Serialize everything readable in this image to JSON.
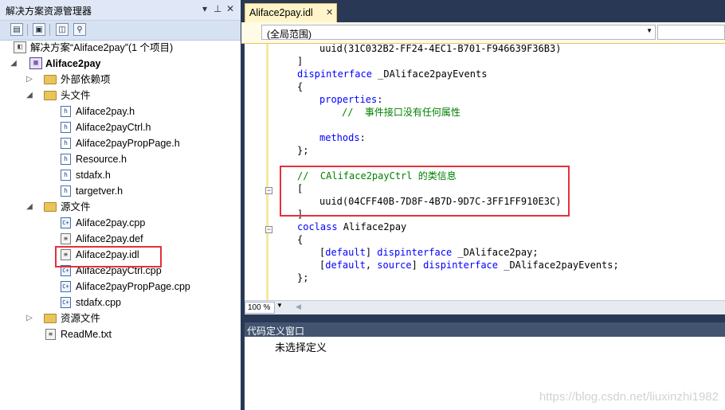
{
  "solution_explorer": {
    "title": "解决方案资源管理器",
    "title_controls": [
      "▾",
      "⊥",
      "✕"
    ],
    "toolbar_icons": [
      "properties-icon",
      "show-all-files-icon",
      "refresh-icon",
      "view-class-diagram-icon"
    ],
    "solution_label": "解决方案“Aliface2pay”(1 个项目)",
    "project_label": "Aliface2pay",
    "tree": {
      "external_deps": "外部依赖项",
      "header_folder": "头文件",
      "headers": [
        "Aliface2pay.h",
        "Aliface2payCtrl.h",
        "Aliface2payPropPage.h",
        "Resource.h",
        "stdafx.h",
        "targetver.h"
      ],
      "source_folder": "源文件",
      "sources": [
        "Aliface2pay.cpp",
        "Aliface2pay.def",
        "Aliface2pay.idl",
        "Aliface2payCtrl.cpp",
        "Aliface2payPropPage.cpp",
        "stdafx.cpp"
      ],
      "resource_folder": "资源文件",
      "readme": "ReadMe.txt"
    },
    "selected_item": "Aliface2pay.idl"
  },
  "editor": {
    "tab_label": "Aliface2pay.idl",
    "tab_close": "✕",
    "scope_label": "(全局范围)",
    "zoom": "100 %",
    "code": {
      "l1": "uuid(31C032B2-FF24-4EC1-B701-F946639F36B3)",
      "l2": "]",
      "l3_kw": "dispinterface",
      "l3_rest": " _DAliface2payEvents",
      "l4": "{",
      "l5_kw": "properties",
      "l5_rest": ":",
      "l6": "//  事件接口没有任何属性",
      "l8_kw": "methods",
      "l8_rest": ":",
      "l9": "};",
      "l11": "//  CAliface2payCtrl 的类信息",
      "l12": "[",
      "l13": "uuid(04CFF40B-7D8F-4B7D-9D7C-3FF1FF910E3C)",
      "l14": "]",
      "l15_kw": "coclass",
      "l15_rest": " Aliface2pay",
      "l16": "{",
      "l17_b1": "[",
      "l17_kw1": "default",
      "l17_b2": "] ",
      "l17_kw2": "dispinterface",
      "l17_rest": " _DAliface2pay;",
      "l18_b1": "[",
      "l18_kw1": "default",
      "l18_sep": ", ",
      "l18_kw2": "source",
      "l18_b2": "] ",
      "l18_kw3": "dispinterface",
      "l18_rest": " _DAliface2payEvents;",
      "l19": "};"
    }
  },
  "code_definition": {
    "title": "代码定义窗口",
    "content": "未选择定义"
  },
  "watermark": "https://blog.csdn.net/liuxinzhi1982",
  "colors": {
    "keyword": "#0000ff",
    "comment": "#008000",
    "highlight_box": "#e5303a"
  }
}
